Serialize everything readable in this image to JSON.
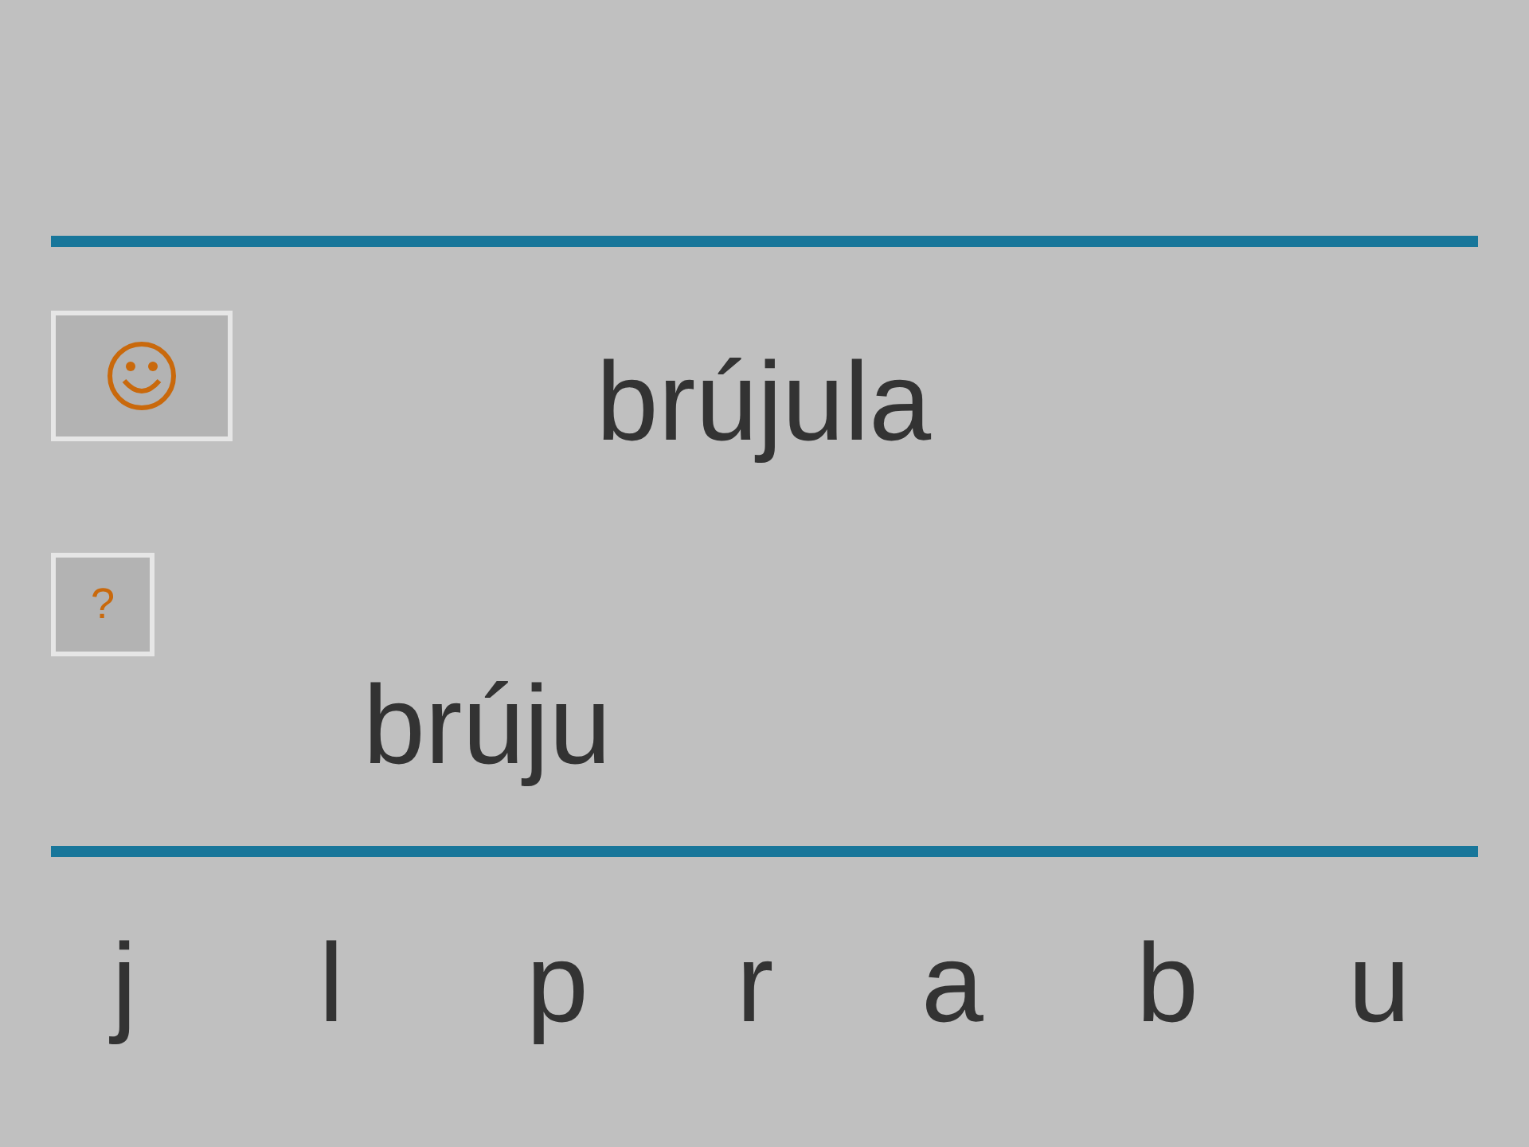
{
  "target_word": "brújula",
  "help_button": {
    "label": "?"
  },
  "answer": "brúju",
  "letters": [
    "j",
    "l",
    "p",
    "r",
    "a",
    "b",
    "u"
  ]
}
